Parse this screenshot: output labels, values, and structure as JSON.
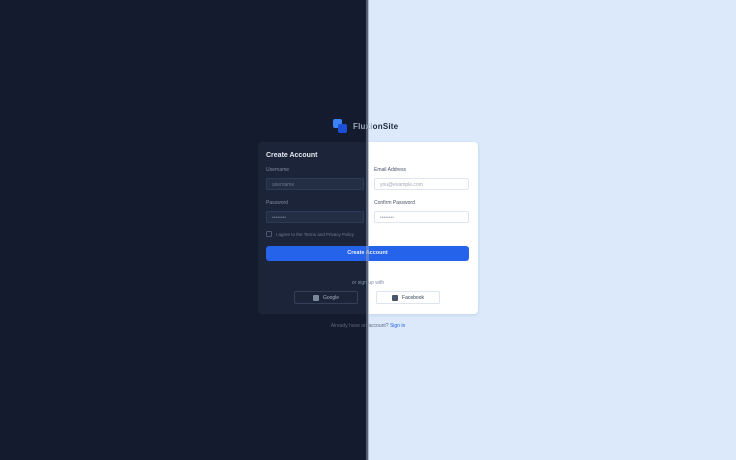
{
  "brand": {
    "name_part1": "Fluxi",
    "name_part2": "onSite"
  },
  "form": {
    "title": "Create Account",
    "fields": {
      "username": {
        "label": "Username",
        "placeholder": "username"
      },
      "email": {
        "label": "Email Address",
        "placeholder": "you@example.com"
      },
      "password": {
        "label": "Password",
        "placeholder": "••••••••"
      },
      "confirm": {
        "label": "Confirm Password",
        "placeholder": "••••••••"
      }
    },
    "terms": "I agree to the Terms and Privacy Policy",
    "submit": "Create Account",
    "divider": "or sign up with",
    "social": {
      "google": "Google",
      "facebook": "Facebook"
    }
  },
  "footer": {
    "prefix": "Already have an account?",
    "link": "Sign in"
  },
  "colors": {
    "accent": "#2563eb",
    "dark_bg": "#141b2e",
    "light_bg": "#dbe9fb"
  }
}
